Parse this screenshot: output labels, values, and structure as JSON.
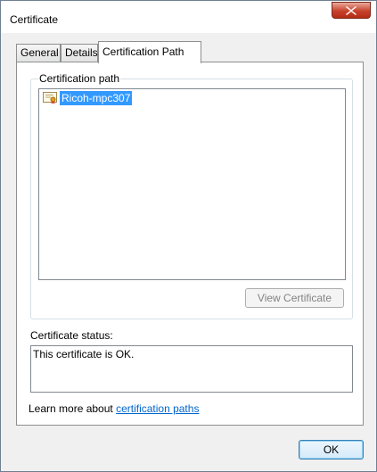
{
  "window": {
    "title": "Certificate"
  },
  "tabs": [
    {
      "label": "General"
    },
    {
      "label": "Details"
    },
    {
      "label": "Certification Path",
      "active": true
    }
  ],
  "path_group": {
    "legend": "Certification path",
    "items": [
      {
        "label": "Ricoh-mpc307",
        "icon": "certificate-icon",
        "selected": true
      }
    ],
    "view_button": "View Certificate"
  },
  "status": {
    "label": "Certificate status:",
    "text": "This certificate is OK."
  },
  "learn_more": {
    "prefix": "Learn more about ",
    "link": "certification paths"
  },
  "buttons": {
    "ok": "OK"
  },
  "colors": {
    "selection": "#3399ff",
    "link": "#0066cc",
    "close": "#c7422b"
  }
}
